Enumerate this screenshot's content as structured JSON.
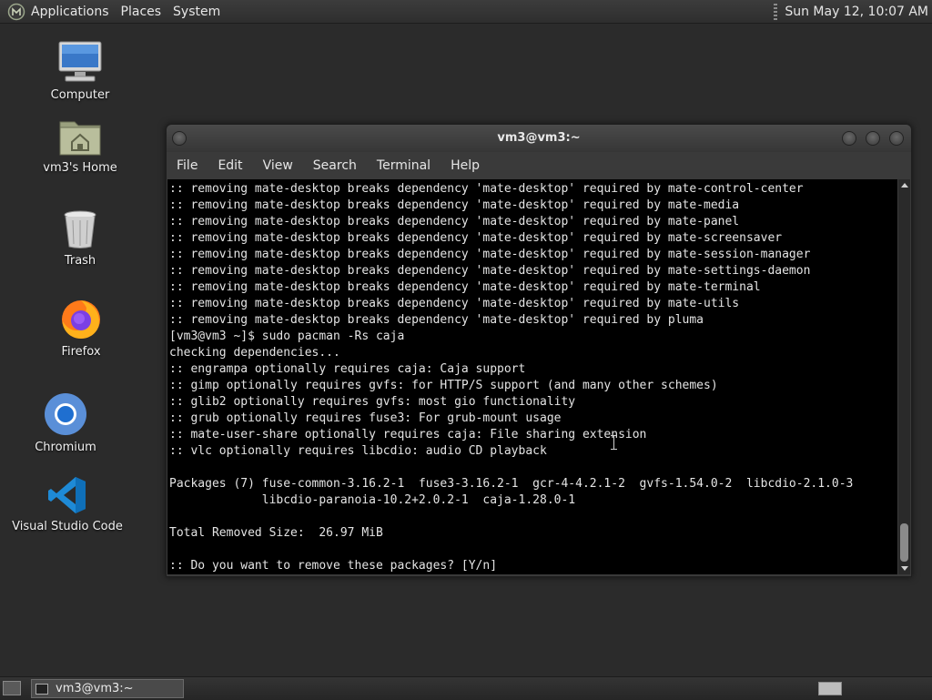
{
  "top_panel": {
    "menus": [
      "Applications",
      "Places",
      "System"
    ],
    "clock": "Sun May 12, 10:07 AM"
  },
  "desktop": {
    "icons": [
      {
        "label": "Computer",
        "icon": "computer-icon"
      },
      {
        "label": "vm3's Home",
        "icon": "home-folder-icon"
      },
      {
        "label": "Trash",
        "icon": "trash-icon"
      },
      {
        "label": "Firefox",
        "icon": "firefox-icon"
      },
      {
        "label": "Chromium",
        "icon": "chromium-icon"
      },
      {
        "label": "Visual Studio Code",
        "icon": "vscode-icon"
      }
    ]
  },
  "terminal": {
    "title": "vm3@vm3:~",
    "menus": [
      "File",
      "Edit",
      "View",
      "Search",
      "Terminal",
      "Help"
    ],
    "lines": [
      ":: removing mate-desktop breaks dependency 'mate-desktop' required by mate-control-center",
      ":: removing mate-desktop breaks dependency 'mate-desktop' required by mate-media",
      ":: removing mate-desktop breaks dependency 'mate-desktop' required by mate-panel",
      ":: removing mate-desktop breaks dependency 'mate-desktop' required by mate-screensaver",
      ":: removing mate-desktop breaks dependency 'mate-desktop' required by mate-session-manager",
      ":: removing mate-desktop breaks dependency 'mate-desktop' required by mate-settings-daemon",
      ":: removing mate-desktop breaks dependency 'mate-desktop' required by mate-terminal",
      ":: removing mate-desktop breaks dependency 'mate-desktop' required by mate-utils",
      ":: removing mate-desktop breaks dependency 'mate-desktop' required by pluma",
      "[vm3@vm3 ~]$ sudo pacman -Rs caja",
      "checking dependencies...",
      ":: engrampa optionally requires caja: Caja support",
      ":: gimp optionally requires gvfs: for HTTP/S support (and many other schemes)",
      ":: glib2 optionally requires gvfs: most gio functionality",
      ":: grub optionally requires fuse3: For grub-mount usage",
      ":: mate-user-share optionally requires caja: File sharing extension",
      ":: vlc optionally requires libcdio: audio CD playback",
      "",
      "Packages (7) fuse-common-3.16.2-1  fuse3-3.16.2-1  gcr-4-4.2.1-2  gvfs-1.54.0-2  libcdio-2.1.0-3",
      "             libcdio-paranoia-10.2+2.0.2-1  caja-1.28.0-1",
      "",
      "Total Removed Size:  26.97 MiB",
      "",
      ":: Do you want to remove these packages? [Y/n]"
    ]
  },
  "taskbar": {
    "items": [
      {
        "label": "vm3@vm3:~"
      }
    ]
  }
}
